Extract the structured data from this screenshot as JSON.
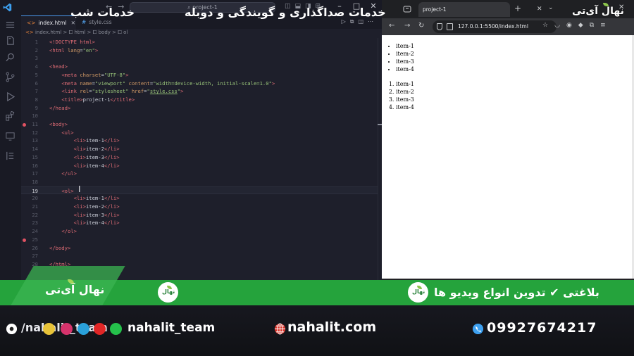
{
  "vscode": {
    "search_text": "project-1",
    "tabs": [
      {
        "label": "index.html",
        "active": true
      },
      {
        "label": "style.css",
        "active": false
      }
    ],
    "breadcrumb": [
      "index.html",
      "html",
      "body",
      "ol"
    ],
    "current_line": 19,
    "lines": [
      {
        "n": 1,
        "html": "<span class='t-doc'>&lt;!DOCTYPE html&gt;</span>"
      },
      {
        "n": 2,
        "html": "<span class='t-tag'>&lt;html</span> <span class='t-attr'>lang</span>=<span class='t-str'>\"en\"</span><span class='t-tag'>&gt;</span>"
      },
      {
        "n": 3,
        "html": ""
      },
      {
        "n": 4,
        "html": "<span class='t-tag'>&lt;head&gt;</span>"
      },
      {
        "n": 5,
        "html": "    <span class='t-tag'>&lt;meta</span> <span class='t-attr'>charset</span>=<span class='t-str'>\"UTF-8\"</span><span class='t-tag'>&gt;</span>"
      },
      {
        "n": 6,
        "html": "    <span class='t-tag'>&lt;meta</span> <span class='t-attr'>name</span>=<span class='t-str'>\"viewport\"</span> <span class='t-attr'>content</span>=<span class='t-str'>\"width=device-width, initial-scale=1.0\"</span><span class='t-tag'>&gt;</span>"
      },
      {
        "n": 7,
        "html": "    <span class='t-tag'>&lt;link</span> <span class='t-attr'>rel</span>=<span class='t-str'>\"stylesheet\"</span> <span class='t-attr'>href</span>=<span class='t-str'>\"<u>style.css</u>\"</span><span class='t-tag'>&gt;</span>"
      },
      {
        "n": 8,
        "html": "    <span class='t-tag'>&lt;title&gt;</span>project-1<span class='t-tag'>&lt;/title&gt;</span>"
      },
      {
        "n": 9,
        "html": "<span class='t-tag'>&lt;/head&gt;</span>"
      },
      {
        "n": 10,
        "html": ""
      },
      {
        "n": 11,
        "html": "<span class='t-tag'>&lt;body&gt;</span>",
        "bp": true
      },
      {
        "n": 12,
        "html": "    <span class='t-tag'>&lt;ul&gt;</span>"
      },
      {
        "n": 13,
        "html": "        <span class='t-tag'>&lt;li&gt;</span>item-1<span class='t-tag'>&lt;/li&gt;</span>"
      },
      {
        "n": 14,
        "html": "        <span class='t-tag'>&lt;li&gt;</span>item-2<span class='t-tag'>&lt;/li&gt;</span>"
      },
      {
        "n": 15,
        "html": "        <span class='t-tag'>&lt;li&gt;</span>item-3<span class='t-tag'>&lt;/li&gt;</span>"
      },
      {
        "n": 16,
        "html": "        <span class='t-tag'>&lt;li&gt;</span>item-4<span class='t-tag'>&lt;/li&gt;</span>"
      },
      {
        "n": 17,
        "html": "    <span class='t-tag'>&lt;/ul&gt;</span>"
      },
      {
        "n": 18,
        "html": ""
      },
      {
        "n": 19,
        "html": "    <span class='t-tag'>&lt;ol&gt;</span>"
      },
      {
        "n": 20,
        "html": "        <span class='t-tag'>&lt;li&gt;</span>item-1<span class='t-tag'>&lt;/li&gt;</span>"
      },
      {
        "n": 21,
        "html": "        <span class='t-tag'>&lt;li&gt;</span>item-2<span class='t-tag'>&lt;/li&gt;</span>"
      },
      {
        "n": 22,
        "html": "        <span class='t-tag'>&lt;li&gt;</span>item-3<span class='t-tag'>&lt;/li&gt;</span>"
      },
      {
        "n": 23,
        "html": "        <span class='t-tag'>&lt;li&gt;</span>item-4<span class='t-tag'>&lt;/li&gt;</span>"
      },
      {
        "n": 24,
        "html": "    <span class='t-tag'>&lt;/ol&gt;</span>"
      },
      {
        "n": 25,
        "html": "",
        "bp": true
      },
      {
        "n": 26,
        "html": "<span class='t-tag'>&lt;/body&gt;</span>"
      },
      {
        "n": 27,
        "html": ""
      },
      {
        "n": 28,
        "html": "<span class='t-tag'>&lt;/html&gt;</span>"
      }
    ]
  },
  "browser": {
    "tab_title": "project-1",
    "url": "127.0.0.1:5500/index.html",
    "ul_items": [
      "item-1",
      "item-2",
      "item-3",
      "item-4"
    ],
    "ol_items": [
      "item-1",
      "item-2",
      "item-3",
      "item-4"
    ]
  },
  "brand": {
    "logo_text": "نهال آی‌تی",
    "banner_right": "بلاغتی ✔ تدوین انواع ویدیو ها",
    "banner_mid": "خدمات صداگذاری و گویندگی و دوبله",
    "banner_left": "خدمات شب",
    "handle_partial": "/nahalit_team",
    "handle": "nahalit_team",
    "website": "nahalit.com",
    "phone": "09927674217"
  },
  "colors": {
    "banner_green": "#25a33c",
    "editor_bg": "#1e1f2b",
    "tag_red": "#e06c75",
    "attr_orange": "#d19a66",
    "string_green": "#98c379"
  }
}
